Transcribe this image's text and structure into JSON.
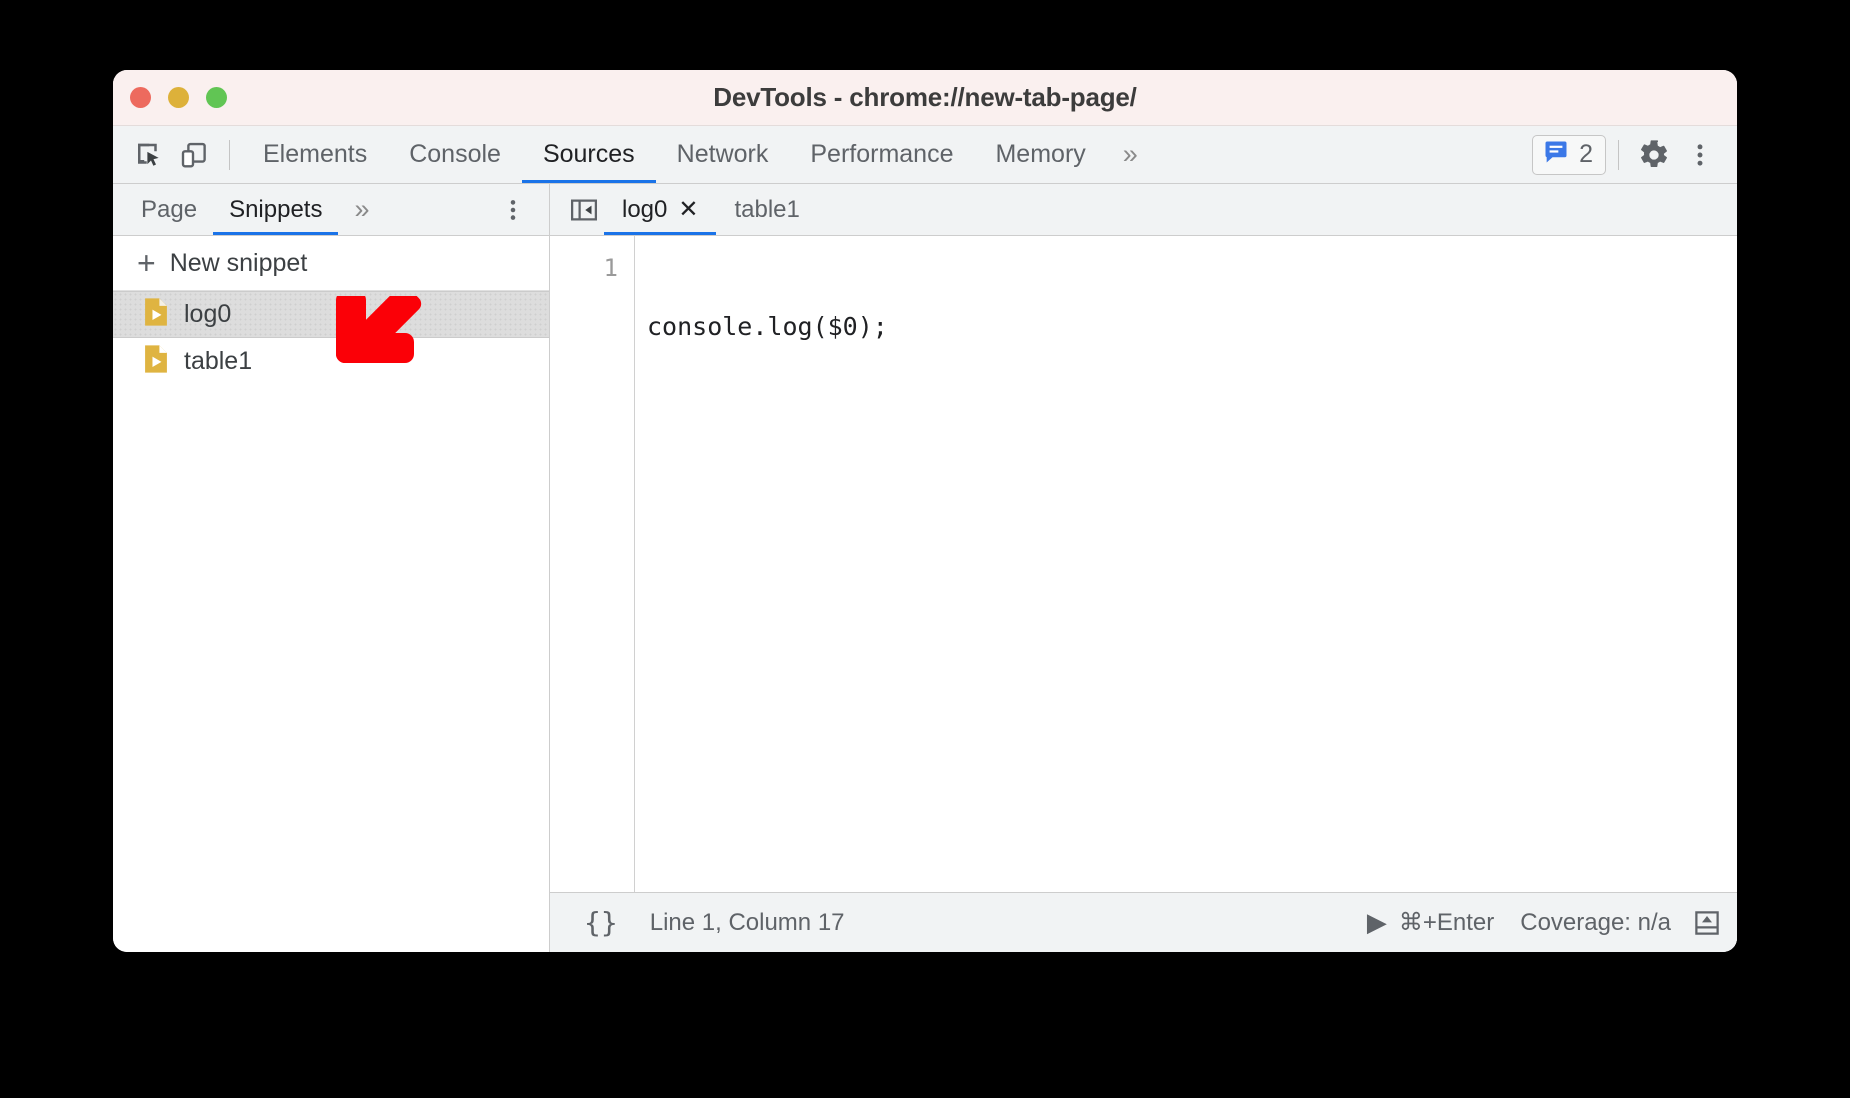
{
  "window": {
    "title": "DevTools - chrome://new-tab-page/",
    "traffic_lights": [
      {
        "name": "close",
        "color": "#ed6a5e"
      },
      {
        "name": "minimize",
        "color": "#ddb13a"
      },
      {
        "name": "zoom",
        "color": "#61c554"
      }
    ]
  },
  "toolbar": {
    "inspect_icon": "inspect-element-icon",
    "device_icon": "device-toolbar-icon",
    "tabs": [
      {
        "label": "Elements",
        "active": false
      },
      {
        "label": "Console",
        "active": false
      },
      {
        "label": "Sources",
        "active": true
      },
      {
        "label": "Network",
        "active": false
      },
      {
        "label": "Performance",
        "active": false
      },
      {
        "label": "Memory",
        "active": false
      }
    ],
    "more_tabs_label": "»",
    "issues_count": "2",
    "issues_icon": "issues-message-icon",
    "settings_icon": "gear-icon",
    "menu_icon": "kebab-menu-icon"
  },
  "navigator": {
    "tabs": [
      {
        "label": "Page",
        "active": false
      },
      {
        "label": "Snippets",
        "active": true
      }
    ],
    "more_tabs_label": "»",
    "menu_icon": "kebab-menu-icon",
    "new_snippet_label": "New snippet",
    "new_snippet_plus": "+",
    "files": [
      {
        "name": "log0",
        "selected": true,
        "icon": "snippet-file-icon"
      },
      {
        "name": "table1",
        "selected": false,
        "icon": "snippet-file-icon"
      }
    ]
  },
  "editor": {
    "collapse_icon": "collapse-sidebar-icon",
    "tabs": [
      {
        "label": "log0",
        "active": true,
        "closable": true
      },
      {
        "label": "table1",
        "active": false,
        "closable": false
      }
    ],
    "close_glyph": "✕",
    "lines": [
      {
        "number": "1",
        "text": "console.log($0);"
      }
    ]
  },
  "statusbar": {
    "format_icon": "{}",
    "cursor_position": "Line 1, Column 17",
    "run_icon": "▶",
    "run_shortcut": "⌘+Enter",
    "coverage": "Coverage: n/a",
    "drawer_icon": "show-drawer-icon"
  },
  "annotation": {
    "arrow": {
      "name": "red-pointer-arrow",
      "direction": "down-left",
      "color": "#fb0007"
    }
  },
  "colors": {
    "accent": "#1a73e8",
    "titlebar_bg": "#faf0ef",
    "toolbar_bg": "#f1f3f4",
    "selection_bg": "#dddddd",
    "snippet_icon": "#dfb441"
  }
}
